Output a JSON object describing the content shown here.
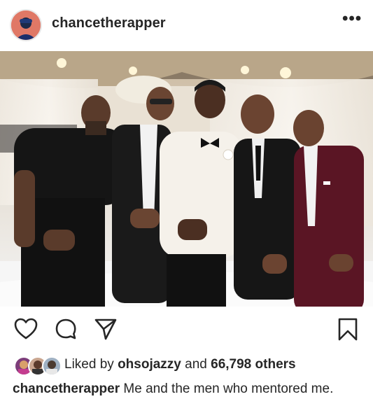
{
  "post": {
    "username": "chancetherapper",
    "more_label": "•••",
    "avatar_icon": "profile-avatar",
    "photo_alt": "",
    "likes": {
      "prefix": "Liked by",
      "first_liker": "ohsojazzy",
      "conjunction": "and",
      "others": "66,798 others"
    },
    "caption": {
      "username": "chancetherapper",
      "text": "Me and the men who mentored me."
    },
    "icons": {
      "like": "heart-icon",
      "comment": "comment-icon",
      "share": "paper-plane-icon",
      "save": "bookmark-icon"
    }
  },
  "colors": {
    "text": "#262626",
    "background": "#ffffff",
    "separator": "#efefef"
  }
}
